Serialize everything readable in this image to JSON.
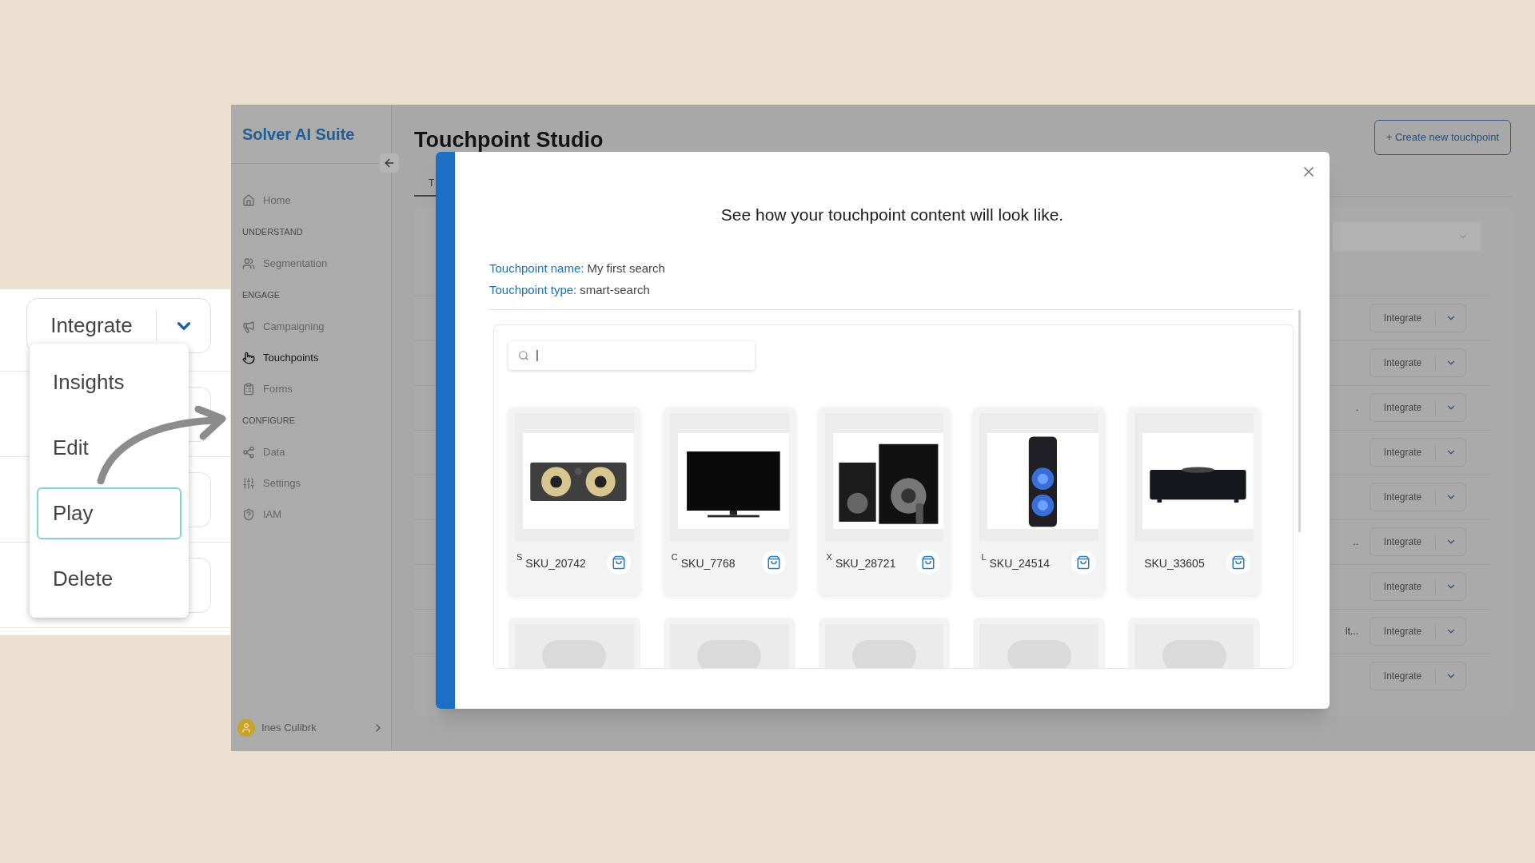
{
  "callout": {
    "split_button": {
      "label": "Integrate"
    },
    "menu": [
      {
        "label": "Insights",
        "selected": false
      },
      {
        "label": "Edit",
        "selected": false
      },
      {
        "label": "Play",
        "selected": true
      },
      {
        "label": "Delete",
        "selected": false
      }
    ]
  },
  "sidebar": {
    "brand": "Solver AI Suite",
    "items": [
      {
        "kind": "item",
        "label": "Home",
        "selected": false
      },
      {
        "kind": "section",
        "label": "UNDERSTAND"
      },
      {
        "kind": "item",
        "label": "Segmentation",
        "selected": false
      },
      {
        "kind": "section",
        "label": "ENGAGE"
      },
      {
        "kind": "item",
        "label": "Campaigning",
        "selected": false
      },
      {
        "kind": "item",
        "label": "Touchpoints",
        "selected": true
      },
      {
        "kind": "item",
        "label": "Forms",
        "selected": false
      },
      {
        "kind": "section",
        "label": "CONFIGURE"
      },
      {
        "kind": "item",
        "label": "Data",
        "selected": false
      },
      {
        "kind": "item",
        "label": "Settings",
        "selected": false
      },
      {
        "kind": "item",
        "label": "IAM",
        "selected": false
      }
    ],
    "user": {
      "name": "Ines Culibrk"
    }
  },
  "page": {
    "title": "Touchpoint Studio",
    "create_button": "+ Create new touchpoint",
    "tab_fragment": "T",
    "rows": [
      {
        "button": "Integrate"
      },
      {
        "button": "Integrate"
      },
      {
        "fragment": ".",
        "button": "Integrate"
      },
      {
        "button": "Integrate"
      },
      {
        "button": "Integrate"
      },
      {
        "fragment": "..",
        "button": "Integrate"
      },
      {
        "button": "Integrate"
      },
      {
        "fragment": "lt...",
        "button": "Integrate"
      },
      {
        "button": "Integrate"
      }
    ]
  },
  "modal": {
    "heading": "See how your touchpoint content will look like.",
    "info": [
      {
        "label": "Touchpoint name:",
        "value": "My first search"
      },
      {
        "label": "Touchpoint type:",
        "value": "smart-search"
      }
    ],
    "search": {
      "value": "|"
    },
    "products": [
      {
        "kind": "product",
        "fragment": "S",
        "sku": "SKU_20742"
      },
      {
        "kind": "product",
        "fragment": "C",
        "sku": "SKU_7768"
      },
      {
        "kind": "product",
        "fragment": "X",
        "sku": "SKU_28721"
      },
      {
        "kind": "product",
        "fragment": "L",
        "sku": "SKU_24514"
      },
      {
        "kind": "product",
        "sku": "SKU_33605"
      },
      {
        "kind": "placeholder"
      },
      {
        "kind": "placeholder"
      },
      {
        "kind": "placeholder"
      },
      {
        "kind": "placeholder"
      },
      {
        "kind": "placeholder"
      }
    ]
  }
}
